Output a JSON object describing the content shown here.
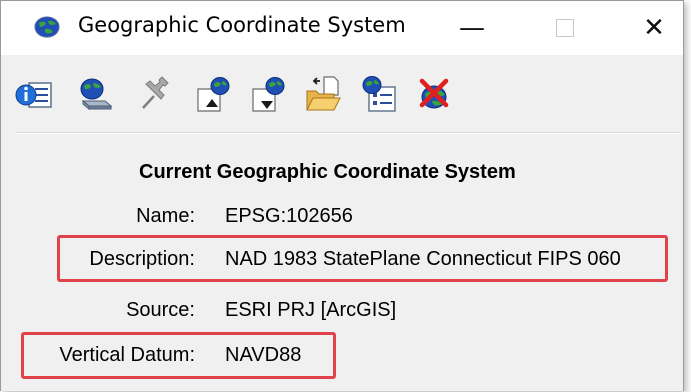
{
  "window": {
    "title": "Geographic Coordinate System",
    "minimize_glyph": "—",
    "close_glyph": "✕"
  },
  "toolbar": {
    "icons": [
      "info-list-icon",
      "globe-database-icon",
      "pin-icon",
      "globe-export-icon",
      "globe-import-icon",
      "open-folder-icon",
      "globe-properties-icon",
      "globe-delete-icon"
    ]
  },
  "content": {
    "heading": "Current Geographic Coordinate System",
    "name_label": "Name:",
    "name_value": "EPSG:102656",
    "description_label": "Description:",
    "description_value": "NAD 1983 StatePlane Connecticut FIPS 060",
    "source_label": "Source:",
    "source_value": "ESRI PRJ [ArcGIS]",
    "vertical_datum_label": "Vertical Datum:",
    "vertical_datum_value": "NAVD88"
  },
  "colors": {
    "highlight": "#e0434a",
    "window_bg": "#f0f0f0",
    "titlebar_bg": "#ffffff"
  }
}
